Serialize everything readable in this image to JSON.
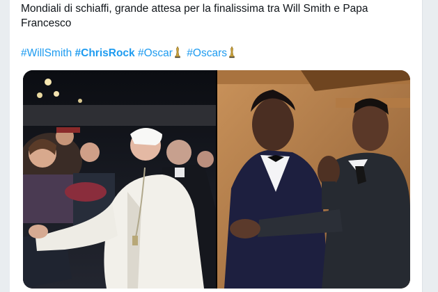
{
  "tweet": {
    "text_line1": "Mondiali di schiaffi, grande attesa per la finalissima tra Will Smith e Papa",
    "text_line2": "Francesco",
    "hashtags": [
      {
        "label": "#WillSmith",
        "bold": false
      },
      {
        "label": "#ChrisRock",
        "bold": true
      },
      {
        "label": "#Oscar",
        "bold": false,
        "emoji": "trophy-icon"
      },
      {
        "label": "#Oscars",
        "bold": false,
        "emoji": "trophy-icon"
      }
    ]
  },
  "media": {
    "photos": [
      {
        "name": "pope-francis-slap-photo"
      },
      {
        "name": "will-smith-chris-rock-slap-photo"
      }
    ]
  },
  "colors": {
    "link": "#1d9bf0",
    "text": "#0f1419",
    "card_bg": "#ffffff",
    "page_bg": "#e9edf0"
  }
}
